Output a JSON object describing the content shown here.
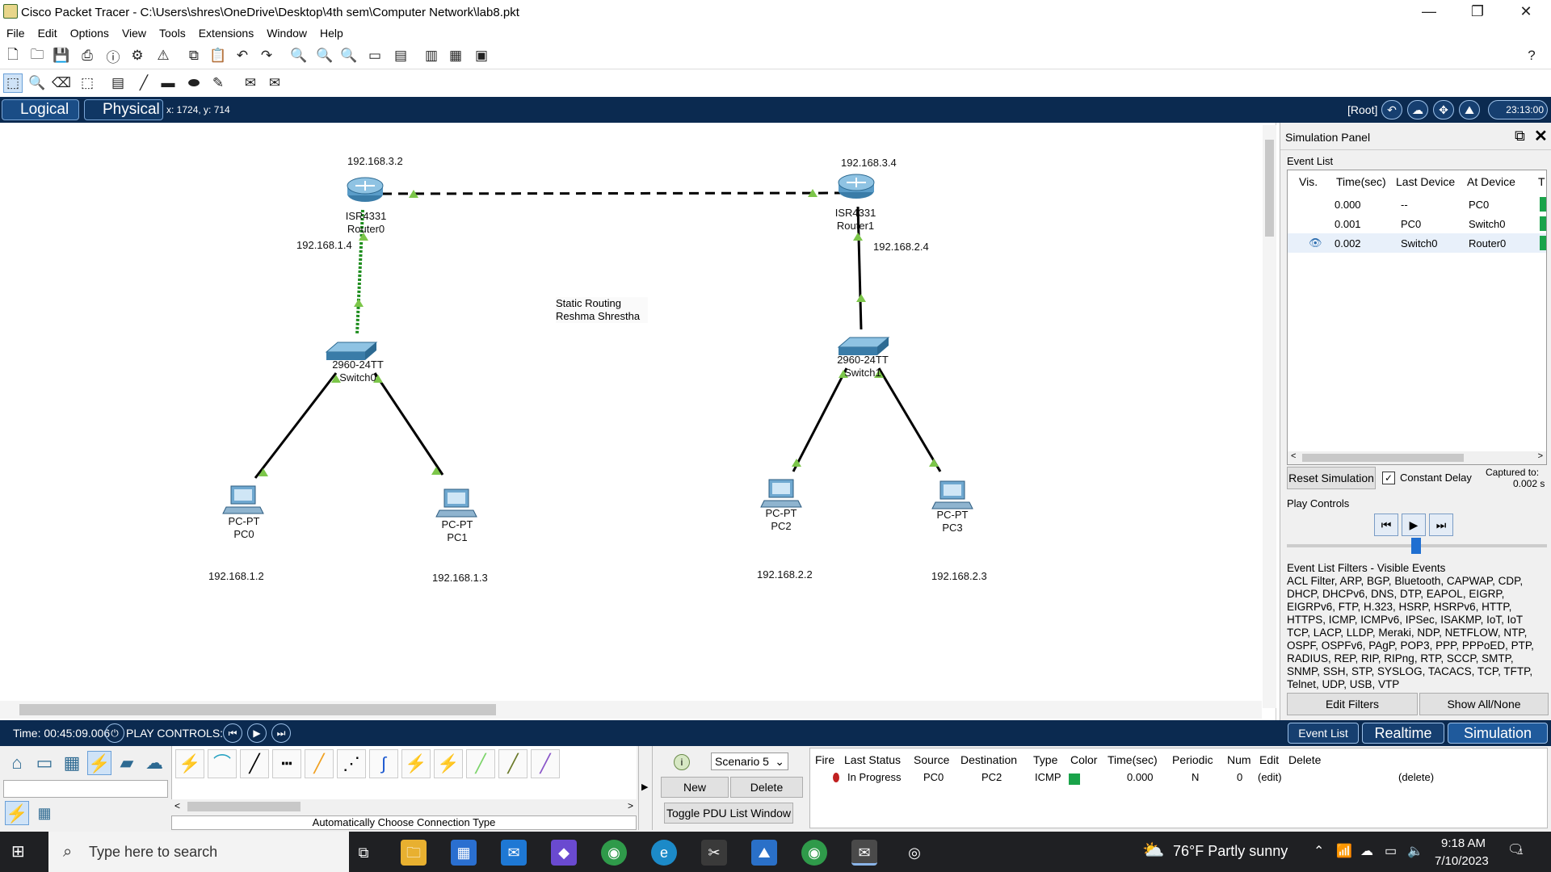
{
  "window": {
    "title": "Cisco Packet Tracer - C:\\Users\\shres\\OneDrive\\Desktop\\4th sem\\Computer Network\\lab8.pkt",
    "minimize": "—",
    "maximize": "❐",
    "close": "✕"
  },
  "menu": [
    "File",
    "Edit",
    "Options",
    "View",
    "Tools",
    "Extensions",
    "Window",
    "Help"
  ],
  "help_icon": "?",
  "viewbar": {
    "logical_label": "Logical",
    "physical_label": "Physical",
    "coordinates": "x: 1724, y: 714",
    "root_label": "[Root]",
    "clock": "23:13:00"
  },
  "topology": {
    "note_line1": "Static Routing",
    "note_line2": "Reshma Shrestha",
    "devices": [
      {
        "model": "ISR4331",
        "name": "Router0"
      },
      {
        "model": "ISR4331",
        "name": "Router1"
      },
      {
        "model": "2960-24TT",
        "name": "Switch0"
      },
      {
        "model": "2960-24TT",
        "name": "Switch1"
      },
      {
        "model": "PC-PT",
        "name": "PC0"
      },
      {
        "model": "PC-PT",
        "name": "PC1"
      },
      {
        "model": "PC-PT",
        "name": "PC2"
      },
      {
        "model": "PC-PT",
        "name": "PC3"
      }
    ],
    "ip_labels": [
      "192.168.3.2",
      "192.168.3.4",
      "192.168.1.4",
      "192.168.2.4",
      "192.168.1.2",
      "192.168.1.3",
      "192.168.2.2",
      "192.168.2.3"
    ]
  },
  "sim_panel": {
    "title": "Simulation Panel",
    "event_list_label": "Event List",
    "columns": [
      "Vis.",
      "Time(sec)",
      "Last Device",
      "At Device",
      "T"
    ],
    "events": [
      {
        "time": "0.000",
        "last": "--",
        "at": "PC0"
      },
      {
        "time": "0.001",
        "last": "PC0",
        "at": "Switch0"
      },
      {
        "time": "0.002",
        "last": "Switch0",
        "at": "Router0"
      }
    ],
    "reset_label": "Reset Simulation",
    "constant_delay_label": "Constant Delay",
    "constant_delay_checked": true,
    "captured_label": "Captured to:",
    "captured_value": "0.002 s",
    "play_controls_label": "Play Controls",
    "filters_title": "Event List Filters - Visible Events",
    "filters_text": "ACL Filter, ARP, BGP, Bluetooth, CAPWAP, CDP, DHCP, DHCPv6, DNS, DTP, EAPOL, EIGRP, EIGRPv6, FTP, H.323, HSRP, HSRPv6, HTTP, HTTPS, ICMP, ICMPv6, IPSec, ISAKMP, IoT, IoT TCP, LACP, LLDP, Meraki, NDP, NETFLOW, NTP, OSPF, OSPFv6, PAgP, POP3, PPP, PPPoED, PTP, RADIUS, REP, RIP, RIPng, RTP, SCCP, SMTP, SNMP, SSH, STP, SYSLOG, TACACS, TCP, TFTP, Telnet, UDP, USB, VTP",
    "edit_filters_label": "Edit Filters",
    "show_all_label": "Show All/None"
  },
  "statusbar": {
    "time": "Time: 00:45:09.006",
    "play_controls": "PLAY CONTROLS:",
    "event_list_btn": "Event List",
    "realtime_btn": "Realtime",
    "simulation_btn": "Simulation"
  },
  "bottom": {
    "connection_hint": "Automatically Choose Connection Type",
    "scenario": "Scenario 5",
    "new_label": "New",
    "delete_label": "Delete",
    "toggle_pdu_label": "Toggle PDU List Window",
    "pdu_columns": [
      "Fire",
      "Last Status",
      "Source",
      "Destination",
      "Type",
      "Color",
      "Time(sec)",
      "Periodic",
      "Num",
      "Edit",
      "Delete"
    ],
    "pdu_row": {
      "status": "In Progress",
      "source": "PC0",
      "destination": "PC2",
      "type": "ICMP",
      "time": "0.000",
      "periodic": "N",
      "num": "0",
      "edit": "(edit)",
      "delete": "(delete)"
    }
  },
  "taskbar": {
    "search_placeholder": "Type here to search",
    "weather": "76°F  Partly sunny",
    "time": "9:18 AM",
    "date": "7/10/2023",
    "notif_count": "1"
  },
  "colors": {
    "navy": "#0b2a50",
    "link_green": "#2aa52a",
    "arrow_green": "#7cc64a",
    "event_green": "#1aa34a"
  }
}
